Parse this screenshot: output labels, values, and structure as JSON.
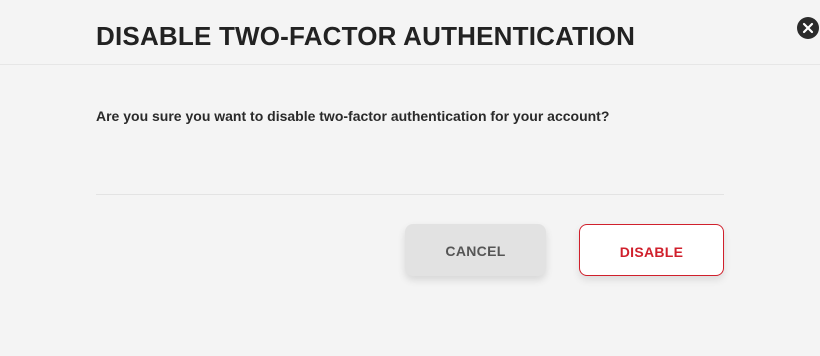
{
  "modal": {
    "title": "DISABLE TWO-FACTOR AUTHENTICATION",
    "message": "Are you sure you want to disable two-factor authentication for your account?",
    "close_icon": "close-icon"
  },
  "actions": {
    "cancel_label": "CANCEL",
    "disable_label": "DISABLE"
  },
  "colors": {
    "background": "#f4f4f4",
    "danger": "#d0202c",
    "cancel_bg": "#e2e2e2",
    "text": "#222222"
  }
}
